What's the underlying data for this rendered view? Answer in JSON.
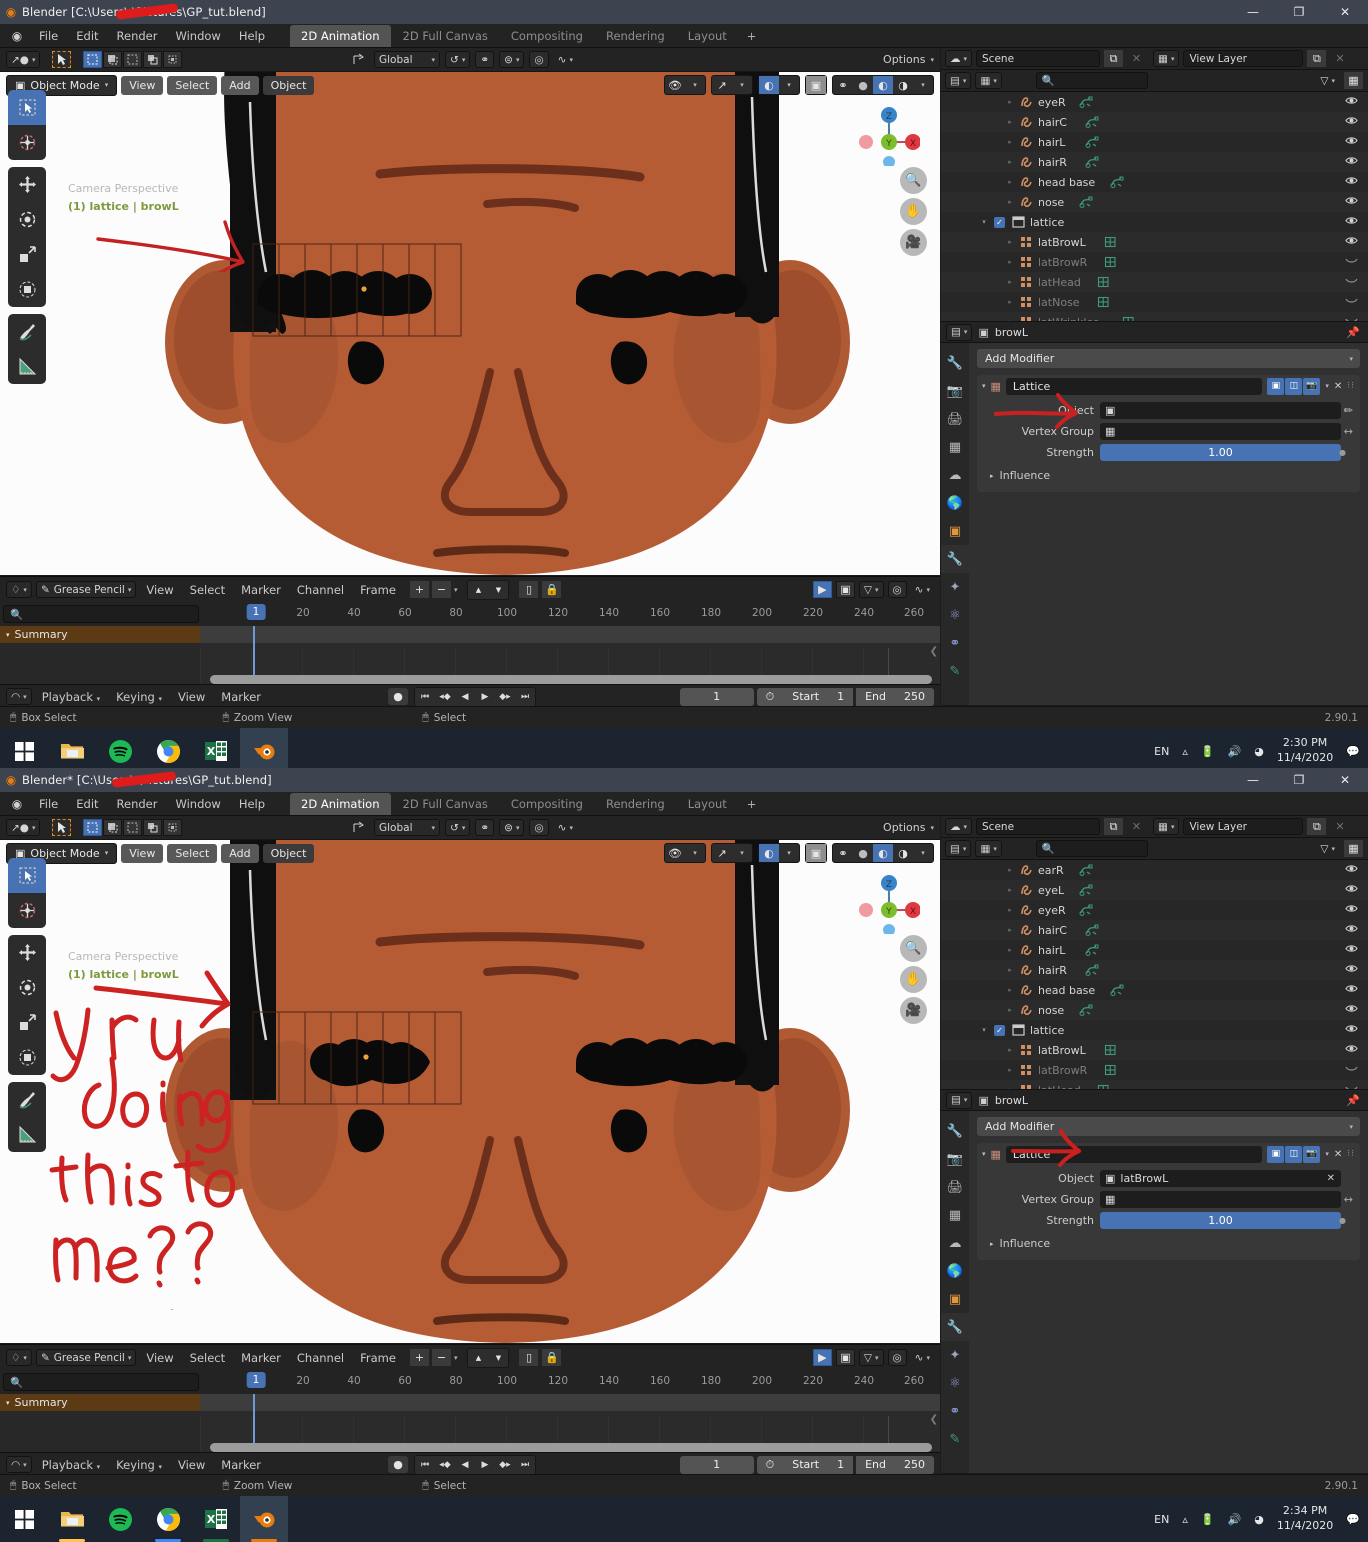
{
  "window1": {
    "title": "Blender [C:\\Users\\        \\Pictures\\GP_tut.blend]",
    "clock_time": "2:30 PM",
    "clock_date": "11/4/2020"
  },
  "window2": {
    "title": "Blender* [C:\\Users\\        \\Pictures\\GP_tut.blend]",
    "clock_time": "2:34 PM",
    "clock_date": "11/4/2020"
  },
  "titlebar_buttons": {
    "minimize": "—",
    "maximize": "❐",
    "close": "✕"
  },
  "topbar": {
    "logo_icon": "blender-logo-icon",
    "menus": [
      "File",
      "Edit",
      "Render",
      "Window",
      "Help"
    ],
    "workspaces": [
      {
        "label": "2D Animation",
        "active": true
      },
      {
        "label": "2D Full Canvas",
        "active": false
      },
      {
        "label": "Compositing",
        "active": false
      },
      {
        "label": "Rendering",
        "active": false
      },
      {
        "label": "Layout",
        "active": false
      }
    ],
    "add_workspace": "+"
  },
  "toolrow": {
    "editor_type_icon": "editor-type-icon",
    "cursor_icon": "tweak-cursor-icon",
    "select_modes": [
      "set-select-icon",
      "extend-select-icon",
      "subtract-select-icon",
      "invert-select-icon",
      "intersect-select-icon"
    ],
    "transform_orientation": "Global",
    "orientation_icon": "orientation-gizmo-icon",
    "pivot_icon": "pivot-point-icon",
    "snap_magnet_icon": "snap-magnet-icon",
    "snap_to_icon": "snap-increment-icon",
    "proportional_icon": "proportional-editing-icon",
    "falloff_icon": "falloff-curve-icon",
    "options_label": "Options"
  },
  "viewport": {
    "mode": "Object Mode",
    "mode_icon": "object-mode-icon",
    "menus": [
      "View",
      "Select",
      "Add",
      "Object"
    ],
    "active_menu": "Object",
    "overlay_camera_text": "Camera Perspective",
    "overlay_object_text": "(1) lattice | browL",
    "visibility_icon": "visibility-eye-icon",
    "gizmo_icon": "gizmo-icon",
    "overlays_icon": "overlays-sphere-icon",
    "xray_icon": "xray-toggle-icon",
    "shading_modes": [
      "wireframe-icon",
      "solid-icon",
      "material-preview-icon",
      "rendered-icon"
    ],
    "active_shading_index": 2,
    "axis_gizmo": {
      "z": "Z",
      "y": "Y",
      "x": "X"
    },
    "nav_buttons": [
      "zoom-icon",
      "pan-hand-icon",
      "camera-view-icon"
    ]
  },
  "annotations": {
    "window1_arrow": "red-arrow-pointing-to-lattice",
    "window1_object_arrow": "red-arrow-pointing-to-object-field",
    "window2_arrow": "red-arrow-pointing-to-object-field",
    "handwriting_lines": [
      "y r u",
      "doing",
      "this to",
      "me??"
    ],
    "color": "#d32020"
  },
  "dopesheet": {
    "editor_icon": "dopesheet-editor-icon",
    "mode": "Grease Pencil",
    "mode_icon": "grease-pencil-icon",
    "menus": [
      "View",
      "Select",
      "Marker",
      "Channel",
      "Frame"
    ],
    "add_icon": "+",
    "remove_icon": "−",
    "dropdown_icon": "chevron-down-icon",
    "up_icon": "▲",
    "down_icon": "▼",
    "only_show_selected_icon": "only-selected-icon",
    "lock_icon": "lock-icon",
    "proportional_icon": "proportional-edit-icon",
    "filter_icon": "filter-funnel-icon",
    "search_placeholder": "",
    "search_icon": "search-icon",
    "channel_summary": "Summary",
    "ticks": [
      20,
      40,
      60,
      80,
      100,
      120,
      140,
      160,
      180,
      200,
      220,
      240,
      260
    ],
    "current_frame_label": "1"
  },
  "timeline_footer": {
    "editor_icon": "timeline-editor-icon",
    "menus": [
      "Playback",
      "Keying",
      "View",
      "Marker"
    ],
    "record_icon": "auto-keying-record-icon",
    "playback_buttons": [
      "jump-to-start-icon",
      "jump-keyframe-prev-icon",
      "play-reverse-icon",
      "play-icon",
      "jump-keyframe-next-icon",
      "jump-to-end-icon"
    ],
    "current_frame": "1",
    "clock_icon": "use-preview-range-icon",
    "start_label": "Start",
    "start_value": "1",
    "end_label": "End",
    "end_value": "250"
  },
  "outliner": {
    "scene_icon": "scene-icon",
    "scene_name": "Scene",
    "new_scene_icon": "copy-icon",
    "remove_scene_icon": "✕",
    "viewlayer_icon": "view-layer-icon",
    "viewlayer_name": "View Layer",
    "new_viewlayer_icon": "copy-icon",
    "remove_viewlayer_icon": "✕",
    "display_mode_icon": "outliner-display-mode-icon",
    "id_type_icon": "id-type-filter-icon",
    "search_icon": "search-icon",
    "search_placeholder": "",
    "filter_icon": "filter-funnel-icon",
    "new_collection_icon": "new-collection-icon",
    "window1_items": [
      {
        "name": "eyeR",
        "icon": "grease-pencil-data-icon",
        "indent": 3,
        "data_icon": "gp-data-icon",
        "visible": true,
        "dim": false
      },
      {
        "name": "hairC",
        "icon": "grease-pencil-data-icon",
        "indent": 3,
        "data_icon": "gp-data-icon",
        "visible": true,
        "dim": false
      },
      {
        "name": "hairL",
        "icon": "grease-pencil-data-icon",
        "indent": 3,
        "data_icon": "gp-data-icon",
        "visible": true,
        "dim": false
      },
      {
        "name": "hairR",
        "icon": "grease-pencil-data-icon",
        "indent": 3,
        "data_icon": "gp-data-icon",
        "visible": true,
        "dim": false
      },
      {
        "name": "head base",
        "icon": "grease-pencil-data-icon",
        "indent": 3,
        "data_icon": "gp-data-icon",
        "visible": true,
        "dim": false
      },
      {
        "name": "nose",
        "icon": "grease-pencil-data-icon",
        "indent": 3,
        "data_icon": "gp-data-icon",
        "visible": true,
        "dim": false
      },
      {
        "name": "lattice",
        "icon": "collection-icon",
        "indent": 2,
        "data_icon": "",
        "visible": true,
        "dim": false,
        "checkbox": true,
        "expanded": true
      },
      {
        "name": "latBrowL",
        "icon": "lattice-object-icon",
        "indent": 3,
        "data_icon": "lattice-data-icon",
        "visible": true,
        "dim": false
      },
      {
        "name": "latBrowR",
        "icon": "lattice-object-icon",
        "indent": 3,
        "data_icon": "lattice-data-icon",
        "visible": false,
        "dim": true
      },
      {
        "name": "latHead",
        "icon": "lattice-object-icon",
        "indent": 3,
        "data_icon": "lattice-data-icon",
        "visible": false,
        "dim": true
      },
      {
        "name": "latNose",
        "icon": "lattice-object-icon",
        "indent": 3,
        "data_icon": "lattice-data-icon",
        "visible": false,
        "dim": true
      },
      {
        "name": "latWrinkles",
        "icon": "lattice-object-icon",
        "indent": 3,
        "data_icon": "lattice-data-icon",
        "visible": false,
        "dim": true
      }
    ],
    "window2_items": [
      {
        "name": "earR",
        "icon": "grease-pencil-data-icon",
        "indent": 3,
        "data_icon": "gp-data-icon",
        "visible": true,
        "dim": false
      },
      {
        "name": "eyeL",
        "icon": "grease-pencil-data-icon",
        "indent": 3,
        "data_icon": "gp-data-icon",
        "visible": true,
        "dim": false
      },
      {
        "name": "eyeR",
        "icon": "grease-pencil-data-icon",
        "indent": 3,
        "data_icon": "gp-data-icon",
        "visible": true,
        "dim": false
      },
      {
        "name": "hairC",
        "icon": "grease-pencil-data-icon",
        "indent": 3,
        "data_icon": "gp-data-icon",
        "visible": true,
        "dim": false
      },
      {
        "name": "hairL",
        "icon": "grease-pencil-data-icon",
        "indent": 3,
        "data_icon": "gp-data-icon",
        "visible": true,
        "dim": false
      },
      {
        "name": "hairR",
        "icon": "grease-pencil-data-icon",
        "indent": 3,
        "data_icon": "gp-data-icon",
        "visible": true,
        "dim": false
      },
      {
        "name": "head base",
        "icon": "grease-pencil-data-icon",
        "indent": 3,
        "data_icon": "gp-data-icon",
        "visible": true,
        "dim": false
      },
      {
        "name": "nose",
        "icon": "grease-pencil-data-icon",
        "indent": 3,
        "data_icon": "gp-data-icon",
        "visible": true,
        "dim": false
      },
      {
        "name": "lattice",
        "icon": "collection-icon",
        "indent": 2,
        "data_icon": "",
        "visible": true,
        "dim": false,
        "checkbox": true,
        "expanded": true
      },
      {
        "name": "latBrowL",
        "icon": "lattice-object-icon",
        "indent": 3,
        "data_icon": "lattice-data-icon",
        "visible": true,
        "dim": false
      },
      {
        "name": "latBrowR",
        "icon": "lattice-object-icon",
        "indent": 3,
        "data_icon": "lattice-data-icon",
        "visible": false,
        "dim": true
      },
      {
        "name": "latHead",
        "icon": "lattice-object-icon",
        "indent": 3,
        "data_icon": "lattice-data-icon",
        "visible": false,
        "dim": true
      }
    ]
  },
  "properties": {
    "breadcrumb_icon": "properties-editor-icon",
    "object_icon": "object-data-icon",
    "object_name": "browL",
    "pin_icon": "pin-icon",
    "tabs": [
      "tool-icon",
      "render-icon",
      "output-icon",
      "view-layer-icon",
      "scene-icon",
      "world-icon",
      "object-icon",
      "modifier-wrench-icon",
      "particles-icon",
      "physics-icon",
      "constraints-icon",
      "object-data-gp-icon"
    ],
    "active_tab_index": 7,
    "add_modifier_label": "Add Modifier",
    "add_modifier_arrow": "chevron-down-icon",
    "modifier": {
      "expand_icon": "triangle-down-icon",
      "type_icon": "lattice-modifier-icon",
      "name": "Lattice",
      "display_toggles": [
        "edit-mode-icon",
        "realtime-display-icon",
        "render-display-icon"
      ],
      "extras_icon": "chevron-down-icon",
      "delete_icon": "✕",
      "drag_icon": "drag-dots-icon",
      "object_label": "Object",
      "object_value_window1": "",
      "object_value_window2": "latBrowL",
      "object_field_icon": "object-picker-icon",
      "eyedropper_icon": "eyedropper-icon",
      "clear_icon": "✕",
      "vertex_group_label": "Vertex Group",
      "vertex_group_value": "",
      "vertex_group_icon": "vertex-group-icon",
      "invert_icon": "invert-arrows-icon",
      "strength_label": "Strength",
      "strength_value": "1.00",
      "animate_icon": "animate-dot-icon",
      "influence_label": "Influence",
      "influence_arrow": "triangle-right-icon"
    }
  },
  "statusbar": {
    "items": [
      {
        "icon": "mouse-left-icon",
        "label": "Box Select"
      },
      {
        "icon": "mouse-middle-icon",
        "label": "Zoom View"
      },
      {
        "icon": "mouse-right-icon",
        "label": "Select"
      }
    ],
    "version": "2.90.1"
  },
  "taskbar": {
    "apps": [
      {
        "name": "start-windows-icon",
        "underline": ""
      },
      {
        "name": "file-explorer-icon",
        "underline": "#ffc64d"
      },
      {
        "name": "spotify-icon",
        "underline": "#1db954"
      },
      {
        "name": "chrome-icon",
        "underline": "#4285f4"
      },
      {
        "name": "excel-icon",
        "underline": "#1f7246"
      },
      {
        "name": "blender-icon",
        "underline": "#e87d0d",
        "active": true
      }
    ],
    "language": "EN",
    "tray_icons": [
      "chevron-up-icon",
      "battery-icon",
      "volume-icon",
      "wifi-icon"
    ],
    "notification_icon": "notification-icon"
  },
  "colors": {
    "accent_blue": "#4772b3",
    "brand_orange": "#e87d0d",
    "annotation_red": "#d32020",
    "summary_channel": "#5c3a14",
    "skin": "#b55c35",
    "skin_dark": "#7d3b22"
  }
}
